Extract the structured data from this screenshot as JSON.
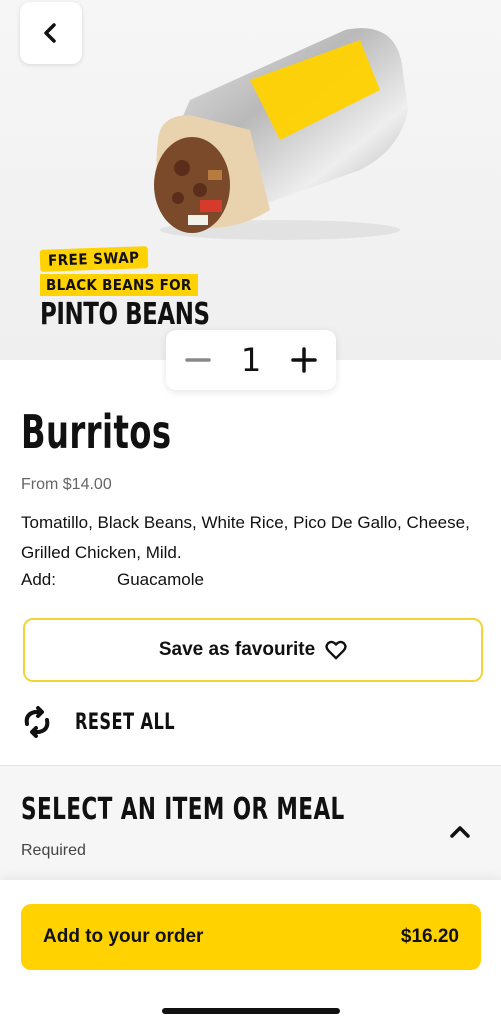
{
  "hero": {
    "promo_swap": "FREE SWAP",
    "promo_line2": "BLACK BEANS FOR",
    "promo_line3": "PINTO BEANS"
  },
  "quantity": {
    "value": "1"
  },
  "item": {
    "title": "Burritos",
    "price_from": "From $14.00",
    "description": "Tomatillo, Black Beans, White Rice, Pico De Gallo, Cheese, Grilled Chicken, Mild.",
    "add_label": "Add:",
    "add_value": "Guacamole"
  },
  "actions": {
    "save_label": "Save as favourite",
    "reset_label": "RESET ALL"
  },
  "section": {
    "title": "SELECT AN ITEM OR MEAL",
    "required": "Required"
  },
  "order": {
    "label": "Add to your order",
    "price": "$16.20"
  },
  "colors": {
    "accent": "#ffd200",
    "border_accent": "#f2d338"
  },
  "icons": [
    "back-chevron-icon",
    "minus-icon",
    "plus-icon",
    "heart-icon",
    "reset-icon",
    "chevron-up-icon"
  ]
}
